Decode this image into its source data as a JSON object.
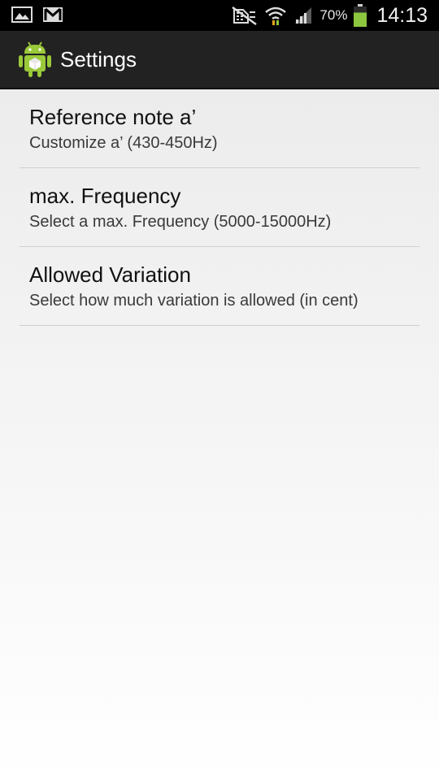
{
  "status_bar": {
    "icons_left": [
      "image-icon",
      "gmail-icon"
    ],
    "icons_right": [
      "no-sim-icon",
      "wifi-icon",
      "signal-icon",
      "battery-icon"
    ],
    "battery_percent": "70%",
    "battery_level": 0.7,
    "time": "14:13"
  },
  "action_bar": {
    "title": "Settings",
    "app_icon": "android-app-icon"
  },
  "preferences": [
    {
      "title": "Reference note a’",
      "summary": "Customize a’ (430-450Hz)"
    },
    {
      "title": "max. Frequency",
      "summary": "Select a max. Frequency (5000-15000Hz)"
    },
    {
      "title": "Allowed Variation",
      "summary": "Select how much variation is allowed (in cent)"
    }
  ],
  "colors": {
    "status_bar_bg": "#000000",
    "action_bar_bg": "#222222",
    "battery_fill": "#8cc63f",
    "android_green": "#9ac93a"
  }
}
